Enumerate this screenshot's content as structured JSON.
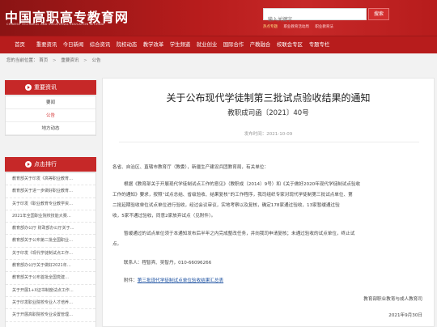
{
  "header": {
    "logo_title": "中国高职高专教育网",
    "logo_subtitle": "CHINESE TECHNICAL AND VOCATIONAL EDUCATION IN CHINA",
    "search_placeholder": "输入关键字",
    "search_button": "搜索",
    "hot_links": [
      "热点专题",
      "职业教育活动周",
      "职业教育法"
    ]
  },
  "nav": [
    "首页",
    "重要资讯",
    "今日新闻",
    "综合资讯",
    "院校动态",
    "教学改革",
    "学生频道",
    "就业创业",
    "国际合作",
    "产教融合",
    "校联会专区",
    "专题专栏"
  ],
  "breadcrumb": [
    "您的当前位置：",
    "首页",
    "重要资讯",
    "公告"
  ],
  "sidebar": {
    "news_head": "重要资讯",
    "news_items": [
      "要闻",
      "公告",
      "地方动态"
    ],
    "rank_head": "点击排行",
    "rank_items": [
      "教育部关于印发《高等职业教育…",
      "教育部关于进一步做好职业教育…",
      "关于印发《职业教育专业教学资…",
      "2021年全国职业院校技能大赛…",
      "教育部办公厅 财政部办公厅关于…",
      "教育部关于公布第二批全国职业…",
      "关于印发《现代学徒制试点工作…",
      "教育部办公厅关于做好2021年…",
      "教育部关于公布首批全国党建…",
      "关于开展1+X证书制度试点工作…",
      "关于印发职业院校专业人才培养…",
      "关于开展高职院校专业设置管理…",
      "关于《高等职业教育创新发展…"
    ]
  },
  "article": {
    "title": "关于公布现代学徒制第三批试点验收结果的通知",
    "doc_no": "教职成司函〔2021〕40号",
    "date_label": "发布时间：2021-10-09",
    "salutation": "各省、自治区、直辖市教育厅（教委），新疆生产建设兵团教育局，有关单位：",
    "para1_lines": [
      "根据《教育部关于开展现代学徒制试点工作的意见》（教职成〔2014〕9号）和《关于做好2020年现代学徒制试点验收",
      "工作的通知》要求，按照“试点总结、省级验收、结果复核”的工作程序，我司组织专家对现代学徒制第三批试点单位、第",
      "二批延期验收单位试点单位进行验收，经过会议审议，实地考察以及复核，确定178家通过验收，13家暂缓通过验",
      "收，5家不通过验收，同意2家放弃试点（见附件）。"
    ],
    "para2_lines": [
      "暂缓通过的试点单位须于本通知发布后半年之内完成整改任务，并向我司申请复核；未通过验收的试点单位，终止试",
      "点。"
    ],
    "contact": "联系人：程智宾、吴智丹，010-66096266",
    "attachment_label": "附件：",
    "attachment_link": "第三批现代学徒制试点单位验收结果汇总表",
    "signature": "教育部职业教育与成人教育司",
    "sign_date": "2021年9月30日"
  },
  "colors": {
    "brand_red": "#c62828",
    "link_blue": "#1a4fa0"
  }
}
